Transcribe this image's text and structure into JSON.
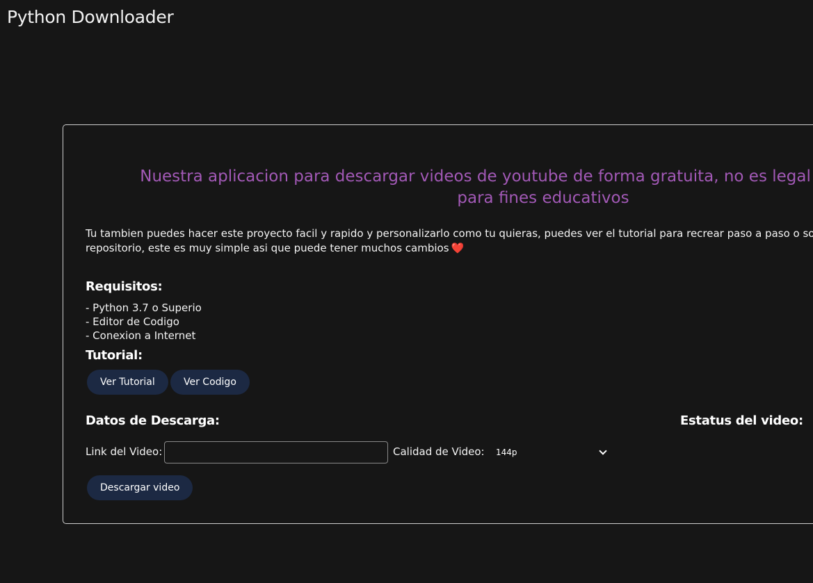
{
  "app": {
    "title": "Python Downloader"
  },
  "card": {
    "headline": [
      "Nuestra aplicacion para descargar videos de youtube de forma gratuita, no es legal el uso comercial",
      "para fines educativos"
    ],
    "intro": [
      "Tu tambien puedes hacer este proyecto facil y rapido y personalizarlo como tu quieras, puedes ver el tutorial para recrear paso a paso o solo ver el",
      "repositorio, este es muy simple asi que puede tener muchos cambios"
    ],
    "heart_icon": "heart-icon",
    "requirements": {
      "title": "Requisitos:",
      "items": [
        "- Python 3.7 o Superio",
        "- Editor de Codigo",
        "- Conexion a Internet"
      ]
    },
    "tutorial": {
      "title": "Tutorial:",
      "view_tutorial_label": "Ver Tutorial",
      "view_code_label": "Ver Codigo"
    },
    "download": {
      "title": "Datos de Descarga:",
      "link_label": "Link del Video:",
      "link_value": "",
      "quality_label": "Calidad de Video:",
      "quality_selected": "144p",
      "download_button_label": "Descargar video"
    },
    "status": {
      "title": "Estatus del video:"
    }
  },
  "colors": {
    "background": "#161616",
    "headline": "#a259b6",
    "button": "#1c2943",
    "heart": "#e0243a"
  }
}
